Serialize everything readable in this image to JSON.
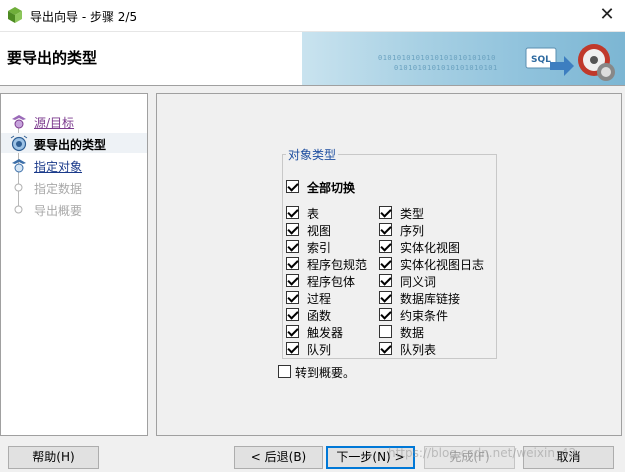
{
  "window": {
    "title": "导出向导 - 步骤 2/5",
    "close_glyph": "✕"
  },
  "header": {
    "title": "要导出的类型",
    "banner_bits": [
      "0101010101010101010101010",
      "0101010101010101010101"
    ],
    "banner_label": "SQL"
  },
  "steps": [
    {
      "label": "源/目标",
      "state": "done"
    },
    {
      "label": "要导出的类型",
      "state": "current"
    },
    {
      "label": "指定对象",
      "state": "link"
    },
    {
      "label": "指定数据",
      "state": "disabled"
    },
    {
      "label": "导出概要",
      "state": "disabled"
    }
  ],
  "object_types": {
    "group_label": "对象类型",
    "toggle_all": {
      "label": "全部切换",
      "checked": true
    },
    "left_column": [
      {
        "label": "表",
        "checked": true
      },
      {
        "label": "视图",
        "checked": true
      },
      {
        "label": "索引",
        "checked": true
      },
      {
        "label": "程序包规范",
        "checked": true
      },
      {
        "label": "程序包体",
        "checked": true
      },
      {
        "label": "过程",
        "checked": true
      },
      {
        "label": "函数",
        "checked": true
      },
      {
        "label": "触发器",
        "checked": true
      },
      {
        "label": "队列",
        "checked": true
      }
    ],
    "right_column": [
      {
        "label": "类型",
        "checked": true
      },
      {
        "label": "序列",
        "checked": true
      },
      {
        "label": "实体化视图",
        "checked": true
      },
      {
        "label": "实体化视图日志",
        "checked": true
      },
      {
        "label": "同义词",
        "checked": true
      },
      {
        "label": "数据库链接",
        "checked": true
      },
      {
        "label": "约束条件",
        "checked": true
      },
      {
        "label": "数据",
        "checked": false
      },
      {
        "label": "队列表",
        "checked": true
      }
    ]
  },
  "goto_summary": {
    "label": "转到概要。",
    "checked": false
  },
  "buttons": {
    "help": "帮助(H)",
    "back": "< 后退(B)",
    "next": "下一步(N) >",
    "finish": "完成(F)",
    "cancel": "取消"
  },
  "watermark": "https://blog.csdn.net/weixin_42"
}
